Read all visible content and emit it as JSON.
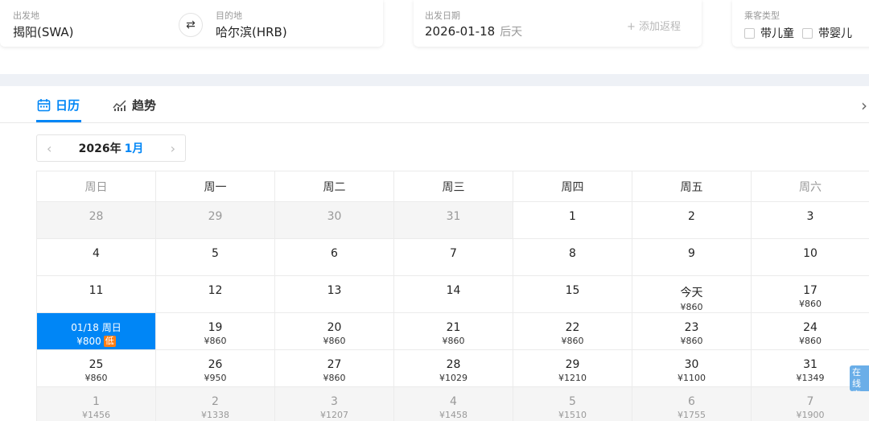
{
  "search": {
    "origin_label": "出发地",
    "origin_value": "揭阳(SWA)",
    "swap_icon": "⇄",
    "destination_label": "目的地",
    "destination_value": "哈尔滨(HRB)",
    "date_label": "出发日期",
    "date_value": "2026-01-18",
    "date_day": "后天",
    "add_return": "+ 添加返程",
    "pax_label": "乘客类型",
    "pax_child": "带儿童",
    "pax_infant": "带婴儿"
  },
  "tabs": {
    "calendar": "日历",
    "trend": "趋势"
  },
  "month_nav": {
    "prev": "‹",
    "next": "›",
    "year": "2026年",
    "month": "1月"
  },
  "weekdays": [
    "周日",
    "周一",
    "周二",
    "周三",
    "周四",
    "周五",
    "周六"
  ],
  "days": [
    {
      "d": "28",
      "p": "",
      "other": true
    },
    {
      "d": "29",
      "p": "",
      "other": true
    },
    {
      "d": "30",
      "p": "",
      "other": true
    },
    {
      "d": "31",
      "p": "",
      "other": true
    },
    {
      "d": "1",
      "p": ""
    },
    {
      "d": "2",
      "p": ""
    },
    {
      "d": "3",
      "p": ""
    },
    {
      "d": "4",
      "p": ""
    },
    {
      "d": "5",
      "p": ""
    },
    {
      "d": "6",
      "p": ""
    },
    {
      "d": "7",
      "p": ""
    },
    {
      "d": "8",
      "p": ""
    },
    {
      "d": "9",
      "p": ""
    },
    {
      "d": "10",
      "p": ""
    },
    {
      "d": "11",
      "p": ""
    },
    {
      "d": "12",
      "p": ""
    },
    {
      "d": "13",
      "p": ""
    },
    {
      "d": "14",
      "p": ""
    },
    {
      "d": "15",
      "p": ""
    },
    {
      "d": "今天",
      "p": "¥860"
    },
    {
      "d": "17",
      "p": "¥860"
    },
    {
      "d": "01/18 周日",
      "p": "¥800",
      "badge": "低",
      "selected": true
    },
    {
      "d": "19",
      "p": "¥860"
    },
    {
      "d": "20",
      "p": "¥860"
    },
    {
      "d": "21",
      "p": "¥860"
    },
    {
      "d": "22",
      "p": "¥860"
    },
    {
      "d": "23",
      "p": "¥860"
    },
    {
      "d": "24",
      "p": "¥860"
    },
    {
      "d": "25",
      "p": "¥860"
    },
    {
      "d": "26",
      "p": "¥950"
    },
    {
      "d": "27",
      "p": "¥860"
    },
    {
      "d": "28",
      "p": "¥1029"
    },
    {
      "d": "29",
      "p": "¥1210"
    },
    {
      "d": "30",
      "p": "¥1100"
    },
    {
      "d": "31",
      "p": "¥1349"
    },
    {
      "d": "1",
      "p": "¥1456",
      "other": true
    },
    {
      "d": "2",
      "p": "¥1338",
      "other": true
    },
    {
      "d": "3",
      "p": "¥1207",
      "other": true
    },
    {
      "d": "4",
      "p": "¥1458",
      "other": true
    },
    {
      "d": "5",
      "p": "¥1510",
      "other": true
    },
    {
      "d": "6",
      "p": "¥1755",
      "other": true
    },
    {
      "d": "7",
      "p": "¥1900",
      "other": true
    }
  ],
  "service_button": "在线客服",
  "colors": {
    "accent": "#0086f6",
    "low_badge": "#ff7d13",
    "other_month_bg": "#f5f5f5"
  }
}
